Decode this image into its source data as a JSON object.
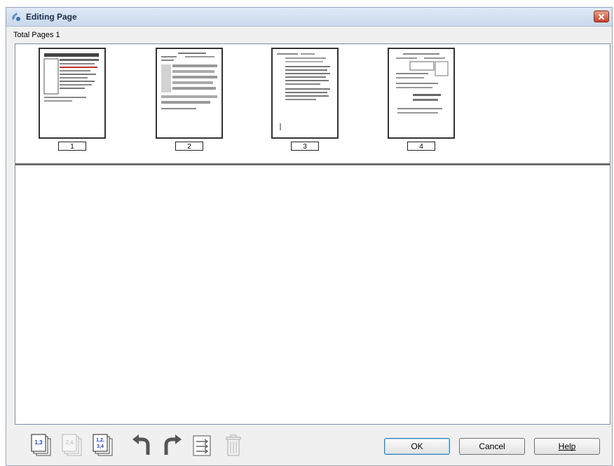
{
  "window": {
    "title": "Editing Page",
    "title_icon": "scanner-app-icon",
    "close_icon": "close-icon"
  },
  "status": {
    "total_pages_label": "Total Pages 1"
  },
  "thumbnails": [
    {
      "number": "1"
    },
    {
      "number": "2"
    },
    {
      "number": "3"
    },
    {
      "number": "4"
    }
  ],
  "toolbar": {
    "tools": [
      {
        "name": "select-odd-pages-icon",
        "glyph": "1,3"
      },
      {
        "name": "select-even-pages-icon",
        "glyph": "2,4"
      },
      {
        "name": "select-all-pages-icon",
        "glyph": "1,2,3,4"
      },
      {
        "name": "rotate-left-icon"
      },
      {
        "name": "rotate-right-icon"
      },
      {
        "name": "reorder-pages-icon"
      },
      {
        "name": "delete-page-icon"
      }
    ]
  },
  "buttons": {
    "ok": "OK",
    "cancel": "Cancel",
    "help": "Help"
  },
  "colors": {
    "titlebar": "#c9d8ec",
    "panel_border": "#7f8ea4",
    "splitter": "#6d6d6d",
    "glyph_blue": "#1c3bd0"
  }
}
